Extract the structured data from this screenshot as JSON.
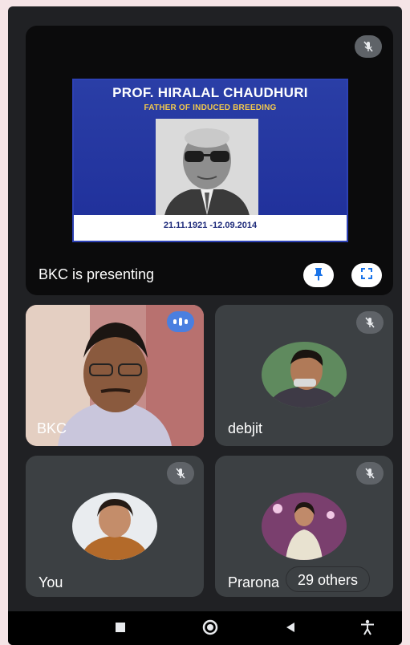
{
  "presentation": {
    "slide_title": "PROF. HIRALAL CHAUDHURI",
    "slide_subtitle": "FATHER OF INDUCED BREEDING",
    "slide_dates": "21.11.1921 -12.09.2014",
    "presenter_label": "BKC is presenting"
  },
  "participants": [
    {
      "name": "BKC",
      "state": "speaking"
    },
    {
      "name": "debjit",
      "state": "muted"
    },
    {
      "name": "You",
      "state": "muted"
    },
    {
      "name": "Prarona",
      "state": "muted"
    }
  ],
  "others_chip": "29 others",
  "icons": {
    "mic_off": "mic-off-icon",
    "pin": "pin-icon",
    "fullscreen": "fullscreen-icon",
    "speaking": "speaking-indicator-icon",
    "nav_recent": "recent-apps-icon",
    "nav_home": "home-icon",
    "nav_back": "back-icon",
    "nav_accessibility": "accessibility-icon"
  },
  "colors": {
    "call_background": "#202124",
    "tile_background": "#3c4043",
    "speaking_accent": "#4a7fe0",
    "slide_blue": "#2a3ea6",
    "slide_subtitle_yellow": "#f2c94c"
  }
}
